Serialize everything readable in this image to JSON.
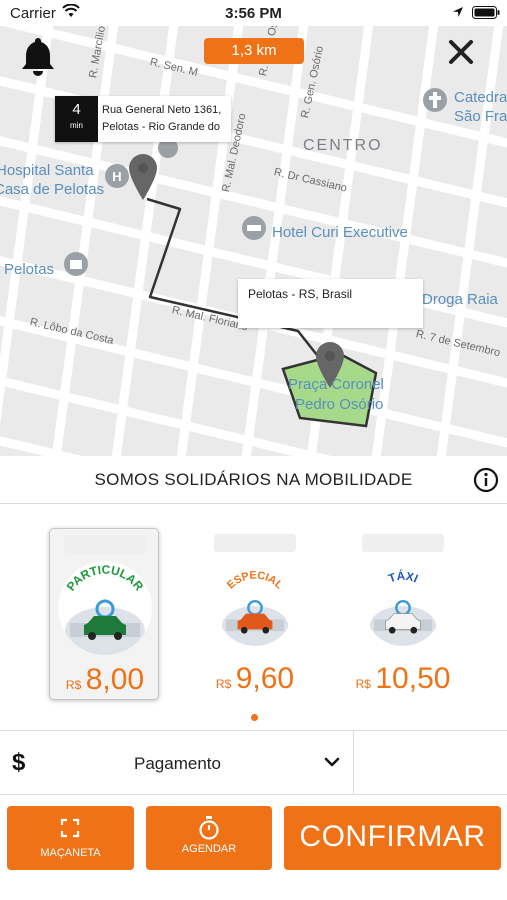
{
  "status_bar": {
    "carrier": "Carrier",
    "time": "3:56 PM"
  },
  "map": {
    "distance": "1,3 km",
    "eta_value": "4",
    "eta_unit": "min",
    "origin_address": "Rua General Neto 1361, Pelotas - Rio Grande do",
    "destination": "Pelotas - RS, Brasil",
    "labels": {
      "hospital_1": "Hospital Santa",
      "hospital_2": "Casa de Pelotas",
      "hotel": "Hotel Curi Executive",
      "pelotas": "Pelotas",
      "centro": "CENTRO",
      "catedral_1": "Catedra",
      "catedral_2": "São Fra",
      "droga": "Droga Raia",
      "park_1": "Praça Coronel",
      "park_2": "Pedro Osório",
      "st_marcilio": "R. Marcílio",
      "st_sen": "R. Sen. M",
      "st_osorio": "R. Gen. Osório",
      "st_gen_osorio": "R. Gen. Osório",
      "st_deodoro": "R. Mal. Deodoro",
      "st_cassiano": "R. Dr Cassiano",
      "st_floriano": "R. Mal. Floriano",
      "st_lobo": "R. Lôbo da Costa",
      "st_7set": "R. 7 de Setembro"
    }
  },
  "slogan": "SOMOS SOLIDÁRIOS NA MOBILIDADE",
  "categories": [
    {
      "name": "PARTICULAR",
      "currency": "R$",
      "price": "8,00",
      "color": "#1e9a3c"
    },
    {
      "name": "ESPECIAL",
      "currency": "R$",
      "price": "9,60",
      "color": "#f07216"
    },
    {
      "name": "TÁXI",
      "currency": "R$",
      "price": "10,50",
      "color": "#1f58b8"
    }
  ],
  "payment": {
    "icon": "dollar-icon",
    "label": "Pagamento"
  },
  "buttons": {
    "door": "MAÇANETA",
    "schedule": "AGENDAR",
    "confirm": "CONFIRMAR"
  },
  "colors": {
    "accent": "#f07216",
    "map_bg": "#eaeaea",
    "park": "#a7d98b"
  }
}
